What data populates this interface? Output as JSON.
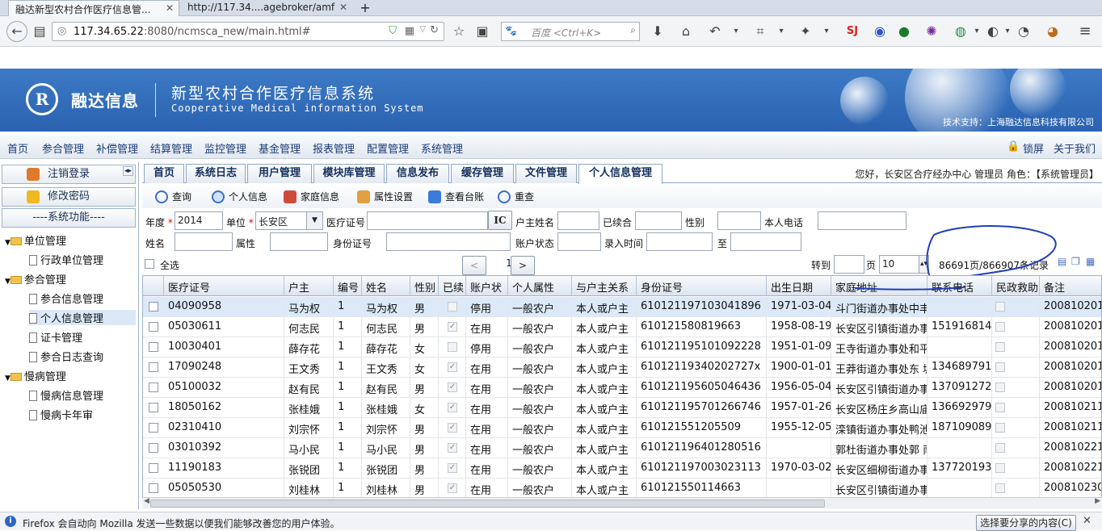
{
  "browser": {
    "tabs": [
      {
        "label": "融达新型农村合作医疗信息管..."
      },
      {
        "label": "http://117.34....agebroker/amf"
      }
    ],
    "url_host": "117.34.65.22",
    "url_rest": ":8080/ncmsca_new/main.html#",
    "search_placeholder": "百度 <Ctrl+K>"
  },
  "banner": {
    "logo": "R",
    "brand": "融达信息",
    "title": "新型农村合作医疗信息系统",
    "subtitle": "Cooperative Medical information System",
    "support": "技术支持：上海融达信息科技有限公司"
  },
  "menu": {
    "items": [
      "首页",
      "参合管理",
      "补偿管理",
      "结算管理",
      "监控管理",
      "基金管理",
      "报表管理",
      "配置管理",
      "系统管理"
    ],
    "lock": "锁屏",
    "about": "关于我们"
  },
  "sidebar": {
    "logout": "注销登录",
    "change_pwd": "修改密码",
    "section": "----系统功能----",
    "groups": [
      {
        "label": "单位管理",
        "items": [
          "行政单位管理"
        ]
      },
      {
        "label": "参合管理",
        "items": [
          "参合信息管理",
          "个人信息管理",
          "证卡管理",
          "参合日志查询"
        ]
      },
      {
        "label": "慢病管理",
        "items": [
          "慢病信息管理",
          "慢病卡年审"
        ]
      }
    ]
  },
  "inner_tabs": [
    "首页",
    "系统日志",
    "用户管理",
    "模块库管理",
    "信息发布",
    "缓存管理",
    "文件管理",
    "个人信息管理"
  ],
  "user_info": "您好，长安区合疗经办中心  管理员   角色：【系统管理员】",
  "toolbar": [
    "查询",
    "个人信息",
    "家庭信息",
    "属性设置",
    "查看台账",
    "重查"
  ],
  "filters": {
    "year_label": "年度",
    "year_value": "2014",
    "unit_label": "单位",
    "unit_value": "长安区",
    "card_label": "医疗证号",
    "ic_button": "IC",
    "owner_label": "户主姓名",
    "renewed_label": "已续合",
    "gender_label": "性别",
    "phone_label": "本人电话",
    "name_label": "姓名",
    "attr_label": "属性",
    "id_label": "身份证号",
    "account_label": "账户状态",
    "entry_label": "录入时间",
    "to_label": "至"
  },
  "pager": {
    "select_all": "全选",
    "page": "1",
    "prev": "<",
    "next": ">",
    "goto_label": "转到",
    "page_label": "页",
    "page_size": "10",
    "summary": "86691页/866907条记录"
  },
  "table": {
    "headers": [
      "医疗证号",
      "户主",
      "编号",
      "姓名",
      "性别",
      "已续",
      "账户状",
      "个人属性",
      "与户主关系",
      "身份证号",
      "出生日期",
      "家庭地址",
      "联系电话",
      "民政救助",
      "备注"
    ],
    "rows": [
      {
        "card": "04090958",
        "owner": "马为权",
        "no": "1",
        "name": "马为权",
        "gender": "男",
        "renewed": false,
        "status": "停用",
        "attr": "一般农户",
        "rel": "本人或户主",
        "id": "610121197103041896",
        "birth": "1971-03-04",
        "addr": "斗门街道办事处中丰",
        "phone": "",
        "note": "200810201"
      },
      {
        "card": "05030611",
        "owner": "何志民",
        "no": "1",
        "name": "何志民",
        "gender": "男",
        "renewed": true,
        "status": "在用",
        "attr": "一般农户",
        "rel": "本人或户主",
        "id": "610121580819663",
        "birth": "1958-08-19",
        "addr": "长安区引镇街道办事",
        "phone": "151916814",
        "note": "200810201"
      },
      {
        "card": "10030401",
        "owner": "薛存花",
        "no": "1",
        "name": "薛存花",
        "gender": "女",
        "renewed": false,
        "status": "停用",
        "attr": "一般农户",
        "rel": "本人或户主",
        "id": "610121195101092228",
        "birth": "1951-01-09",
        "addr": "王寺街道办事处和平",
        "phone": "",
        "note": "200810201"
      },
      {
        "card": "17090248",
        "owner": "王文秀",
        "no": "1",
        "name": "王文秀",
        "gender": "女",
        "renewed": true,
        "status": "在用",
        "attr": "一般农户",
        "rel": "本人或户主",
        "id": "61012119340202727x",
        "birth": "1900-01-01",
        "addr": "王莽街道办事处东 坡",
        "phone": "134689791",
        "note": "200810201"
      },
      {
        "card": "05100032",
        "owner": "赵有民",
        "no": "1",
        "name": "赵有民",
        "gender": "男",
        "renewed": true,
        "status": "在用",
        "attr": "一般农户",
        "rel": "本人或户主",
        "id": "610121195605046436",
        "birth": "1956-05-04",
        "addr": "长安区引镇街道办事",
        "phone": "137091272",
        "note": "200810201"
      },
      {
        "card": "18050162",
        "owner": "张桂娥",
        "no": "1",
        "name": "张桂娥",
        "gender": "女",
        "renewed": true,
        "status": "在用",
        "attr": "一般农户",
        "rel": "本人或户主",
        "id": "610121195701266746",
        "birth": "1957-01-26",
        "addr": "长安区杨庄乡高山庙",
        "phone": "136692979",
        "note": "200810211"
      },
      {
        "card": "02310410",
        "owner": "刘宗怀",
        "no": "1",
        "name": "刘宗怀",
        "gender": "男",
        "renewed": true,
        "status": "在用",
        "attr": "一般农户",
        "rel": "本人或户主",
        "id": "610121551205509",
        "birth": "1955-12-05",
        "addr": "滦镇街道办事处鸭池",
        "phone": "187109089",
        "note": "200810211"
      },
      {
        "card": "03010392",
        "owner": "马小民",
        "no": "1",
        "name": "马小民",
        "gender": "男",
        "renewed": true,
        "status": "在用",
        "attr": "一般农户",
        "rel": "本人或户主",
        "id": "610121196401280516",
        "birth": "",
        "addr": "郭杜街道办事处郭 南",
        "phone": "",
        "note": "200810221"
      },
      {
        "card": "11190183",
        "owner": "张锐团",
        "no": "1",
        "name": "张锐团",
        "gender": "男",
        "renewed": true,
        "status": "在用",
        "attr": "一般农户",
        "rel": "本人或户主",
        "id": "610121197003023113",
        "birth": "1970-03-02",
        "addr": "长安区细柳街道办事",
        "phone": "137720193",
        "note": "200810221"
      },
      {
        "card": "05050530",
        "owner": "刘桂林",
        "no": "1",
        "name": "刘桂林",
        "gender": "男",
        "renewed": true,
        "status": "在用",
        "attr": "一般农户",
        "rel": "本人或户主",
        "id": "610121550114663",
        "birth": "",
        "addr": "长安区引镇街道办事",
        "phone": "",
        "note": "200810230"
      }
    ]
  },
  "notification": {
    "text": "Firefox 会自动向 Mozilla 发送一些数据以便我们能够改善您的用户体验。",
    "button": "选择要分享的内容(C)"
  },
  "colors": {
    "banner": "#2f6ab8",
    "menu_text": "#1a3c77",
    "annotation": "#1f3fb8",
    "required": "#dd0000",
    "row_highlight": "#dbe9f8"
  }
}
